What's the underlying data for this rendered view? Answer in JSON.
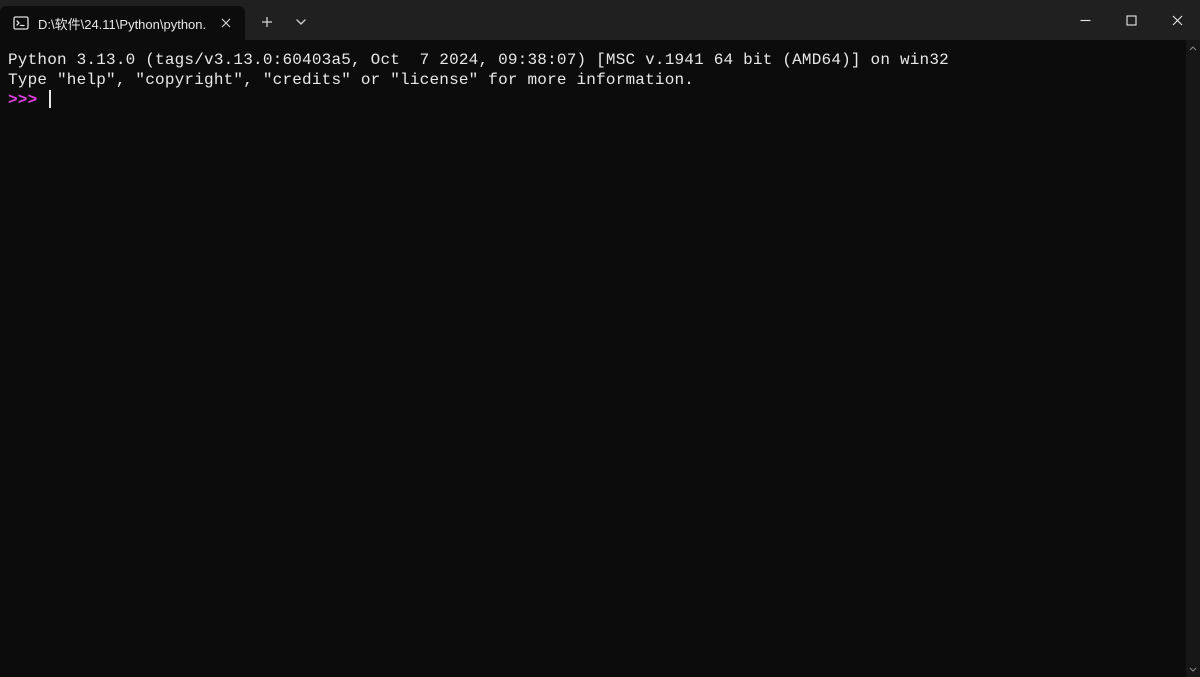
{
  "tab": {
    "title": "D:\\软件\\24.11\\Python\\python."
  },
  "terminal": {
    "line1": "Python 3.13.0 (tags/v3.13.0:60403a5, Oct  7 2024, 09:38:07) [MSC v.1941 64 bit (AMD64)] on win32",
    "line2": "Type \"help\", \"copyright\", \"credits\" or \"license\" for more information.",
    "prompt": ">>>"
  }
}
